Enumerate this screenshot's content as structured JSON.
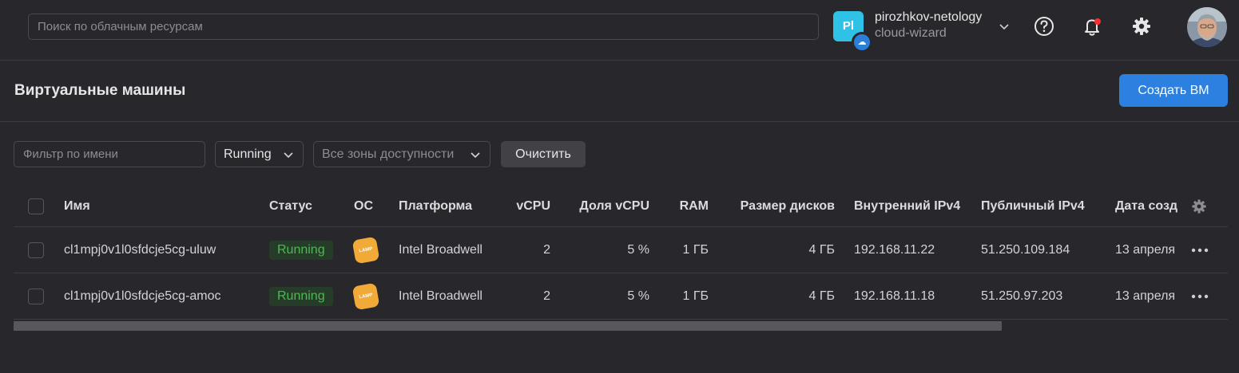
{
  "header": {
    "search_placeholder": "Поиск по облачным ресурсам",
    "account_initials": "Pl",
    "account_name": "pirozhkov-netology",
    "folder_name": "cloud-wizard"
  },
  "page": {
    "title": "Виртуальные машины",
    "create_button": "Создать ВМ"
  },
  "filters": {
    "name_placeholder": "Фильтр по имени",
    "status_value": "Running",
    "zone_placeholder": "Все зоны доступности",
    "clear_button": "Очистить"
  },
  "table": {
    "columns": [
      "Имя",
      "Статус",
      "ОС",
      "Платформа",
      "vCPU",
      "Доля vCPU",
      "RAM",
      "Размер дисков",
      "Внутренний IPv4",
      "Публичный IPv4",
      "Дата созд"
    ],
    "rows": [
      {
        "name": "cl1mpj0v1l0sfdcje5cg-uluw",
        "status": "Running",
        "os_badge": "LAMP",
        "platform": "Intel Broadwell",
        "vcpu": "2",
        "vcpu_share": "5 %",
        "ram": "1 ГБ",
        "disk": "4 ГБ",
        "internal_ip": "192.168.11.22",
        "public_ip": "51.250.109.184",
        "date": "13 апреля"
      },
      {
        "name": "cl1mpj0v1l0sfdcje5cg-amoc",
        "status": "Running",
        "os_badge": "LAMP",
        "platform": "Intel Broadwell",
        "vcpu": "2",
        "vcpu_share": "5 %",
        "ram": "1 ГБ",
        "disk": "4 ГБ",
        "internal_ip": "192.168.11.18",
        "public_ip": "51.250.97.203",
        "date": "13 апреля"
      }
    ]
  },
  "colors": {
    "background": "#28272c",
    "accent": "#2b80e0",
    "status_green": "#4fb755",
    "lamp_orange": "#f1a937",
    "notification_red": "#ff2d2d"
  },
  "icons": [
    "cloud-icon",
    "chevron-down-icon",
    "help-icon",
    "bell-icon",
    "gear-icon",
    "more-icon"
  ]
}
